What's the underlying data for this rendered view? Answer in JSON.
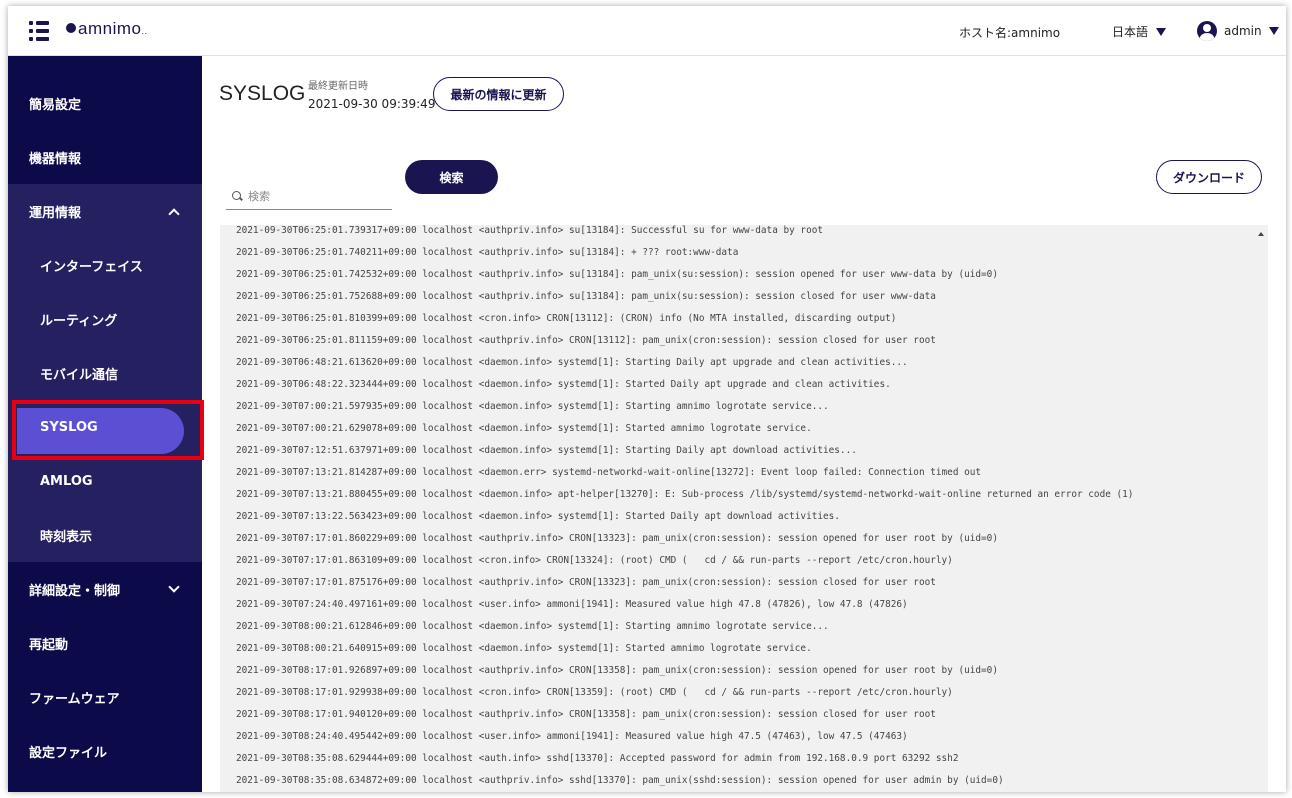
{
  "header": {
    "logo": "amnimo",
    "logo_suffix": "..",
    "host_label": "ホスト名:amnimo",
    "language": "日本語",
    "user": "admin"
  },
  "sidebar": {
    "items": [
      {
        "label": "簡易設定"
      },
      {
        "label": "機器情報"
      },
      {
        "label": "運用情報"
      },
      {
        "label": "インターフェイス"
      },
      {
        "label": "ルーティング"
      },
      {
        "label": "モバイル通信"
      },
      {
        "label": "SYSLOG"
      },
      {
        "label": "AMLOG"
      },
      {
        "label": "時刻表示"
      },
      {
        "label": "詳細設定・制御"
      },
      {
        "label": "再起動"
      },
      {
        "label": "ファームウェア"
      },
      {
        "label": "設定ファイル"
      }
    ]
  },
  "main": {
    "title": "SYSLOG",
    "last_updated_label": "最終更新日時",
    "last_updated_value": "2021-09-30 09:39:49",
    "refresh_button": "最新の情報に更新",
    "search_placeholder": "検索",
    "search_button": "検索",
    "download_button": "ダウンロード"
  },
  "log": [
    "2021-09-30T06:25:01.739317+09:00 localhost <authpriv.info> su[13184]: Successful su for www-data by root",
    "2021-09-30T06:25:01.740211+09:00 localhost <authpriv.info> su[13184]: + ??? root:www-data",
    "2021-09-30T06:25:01.742532+09:00 localhost <authpriv.info> su[13184]: pam_unix(su:session): session opened for user www-data by (uid=0)",
    "2021-09-30T06:25:01.752688+09:00 localhost <authpriv.info> su[13184]: pam_unix(su:session): session closed for user www-data",
    "2021-09-30T06:25:01.810399+09:00 localhost <cron.info> CRON[13112]: (CRON) info (No MTA installed, discarding output)",
    "2021-09-30T06:25:01.811159+09:00 localhost <authpriv.info> CRON[13112]: pam_unix(cron:session): session closed for user root",
    "2021-09-30T06:48:21.613620+09:00 localhost <daemon.info> systemd[1]: Starting Daily apt upgrade and clean activities...",
    "2021-09-30T06:48:22.323444+09:00 localhost <daemon.info> systemd[1]: Started Daily apt upgrade and clean activities.",
    "2021-09-30T07:00:21.597935+09:00 localhost <daemon.info> systemd[1]: Starting amnimo logrotate service...",
    "2021-09-30T07:00:21.629078+09:00 localhost <daemon.info> systemd[1]: Started amnimo logrotate service.",
    "2021-09-30T07:12:51.637971+09:00 localhost <daemon.info> systemd[1]: Starting Daily apt download activities...",
    "2021-09-30T07:13:21.814287+09:00 localhost <daemon.err> systemd-networkd-wait-online[13272]: Event loop failed: Connection timed out",
    "2021-09-30T07:13:21.880455+09:00 localhost <daemon.info> apt-helper[13270]: E: Sub-process /lib/systemd/systemd-networkd-wait-online returned an error code (1)",
    "2021-09-30T07:13:22.563423+09:00 localhost <daemon.info> systemd[1]: Started Daily apt download activities.",
    "2021-09-30T07:17:01.860229+09:00 localhost <authpriv.info> CRON[13323]: pam_unix(cron:session): session opened for user root by (uid=0)",
    "2021-09-30T07:17:01.863109+09:00 localhost <cron.info> CRON[13324]: (root) CMD (   cd / && run-parts --report /etc/cron.hourly)",
    "2021-09-30T07:17:01.875176+09:00 localhost <authpriv.info> CRON[13323]: pam_unix(cron:session): session closed for user root",
    "2021-09-30T07:24:40.497161+09:00 localhost <user.info> ammoni[1941]: Measured value high 47.8 (47826), low 47.8 (47826)",
    "2021-09-30T08:00:21.612846+09:00 localhost <daemon.info> systemd[1]: Starting amnimo logrotate service...",
    "2021-09-30T08:00:21.640915+09:00 localhost <daemon.info> systemd[1]: Started amnimo logrotate service.",
    "2021-09-30T08:17:01.926897+09:00 localhost <authpriv.info> CRON[13358]: pam_unix(cron:session): session opened for user root by (uid=0)",
    "2021-09-30T08:17:01.929938+09:00 localhost <cron.info> CRON[13359]: (root) CMD (   cd / && run-parts --report /etc/cron.hourly)",
    "2021-09-30T08:17:01.940120+09:00 localhost <authpriv.info> CRON[13358]: pam_unix(cron:session): session closed for user root",
    "2021-09-30T08:24:40.495442+09:00 localhost <user.info> ammoni[1941]: Measured value high 47.5 (47463), low 47.5 (47463)",
    "2021-09-30T08:35:08.629444+09:00 localhost <auth.info> sshd[13370]: Accepted password for admin from 192.168.0.9 port 63292 ssh2",
    "2021-09-30T08:35:08.634872+09:00 localhost <authpriv.info> sshd[13370]: pam_unix(sshd:session): session opened for user admin by (uid=0)"
  ]
}
